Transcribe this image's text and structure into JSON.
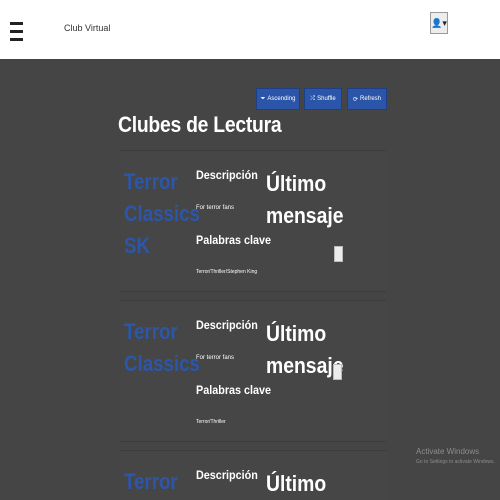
{
  "navbar": {
    "brand": "Club Virtual",
    "menu_icon": "hamburger-icon",
    "user_icon": "user-icon",
    "user_label": "👤▾"
  },
  "toolbar": {
    "ascending_label": "Ascending",
    "shuffle_label": "Shuffle",
    "refresh_label": "Refresh",
    "ascending_icon": "⏷",
    "shuffle_icon": "⤮",
    "refresh_icon": "⟳",
    "accent_color": "#2b55a8"
  },
  "page": {
    "title": "Clubes de Lectura"
  },
  "clubs": [
    {
      "name": "Terror Classics SK",
      "description_label": "Descripción",
      "description": "For terror fans",
      "keywords_label": "Palabras clave",
      "keywords": "Terror/Thriller/Stephen King",
      "last_message_label": "Último mensaje"
    },
    {
      "name": "Terror Classics",
      "description_label": "Descripción",
      "description": "For terror fans",
      "keywords_label": "Palabras clave",
      "keywords": "Terror/Thriller",
      "last_message_label": "Último mensaje"
    },
    {
      "name": "Terror",
      "description_label": "Descripción",
      "description": "",
      "keywords_label": "",
      "keywords": "",
      "last_message_label": "Último"
    }
  ],
  "watermark": {
    "title": "Activate Windows",
    "subtitle": "Go to Settings to activate Windows."
  }
}
